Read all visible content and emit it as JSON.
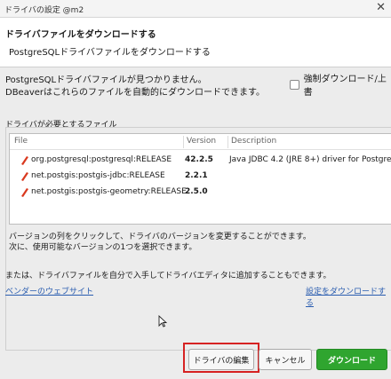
{
  "window": {
    "title": "ドライバの設定 @m2"
  },
  "header": {
    "title": "ドライバファイルをダウンロードする",
    "subtitle": "PostgreSQLドライバファイルをダウンロードする"
  },
  "message": {
    "line1": "PostgreSQLドライバファイルが見つかりません。",
    "line2": "DBeaverはこれらのファイルを自動的にダウンロードできます。"
  },
  "force_download": {
    "label": "強制ダウンロード/上書",
    "checked": false
  },
  "files_group": {
    "label": "ドライバが必要とするファイル",
    "columns": [
      "File",
      "Version",
      "Description"
    ],
    "rows": [
      {
        "file": "org.postgresql:postgresql:RELEASE",
        "version": "42.2.5",
        "description": "Java JDBC 4.2 (JRE 8+) driver for Postgre"
      },
      {
        "file": "net.postgis:postgis-jdbc:RELEASE",
        "version": "2.2.1",
        "description": ""
      },
      {
        "file": "net.postgis:postgis-geometry:RELEASE",
        "version": "2.5.0",
        "description": ""
      }
    ],
    "note1": "バージョンの列をクリックして、ドライバのバージョンを変更することができます。",
    "note2": "次に、使用可能なバージョンの1つを選択できます。"
  },
  "manual_note": "または、ドライバファイルを自分で入手してドライバエディタに追加することもできます。",
  "links": {
    "vendor": "ベンダーのウェブサイト",
    "settings": "設定をダウンロードする"
  },
  "buttons": {
    "edit": "ドライバの編集",
    "cancel": "キャンセル",
    "download": "ダウンロード"
  },
  "colors": {
    "highlight": "#d62222",
    "download_button": "#2fa52f",
    "link": "#2a5db0",
    "file_icon": "#d9381e"
  },
  "icons": {
    "close": "close-icon",
    "file": "jar-file-icon",
    "cursor": "mouse-cursor-icon"
  }
}
